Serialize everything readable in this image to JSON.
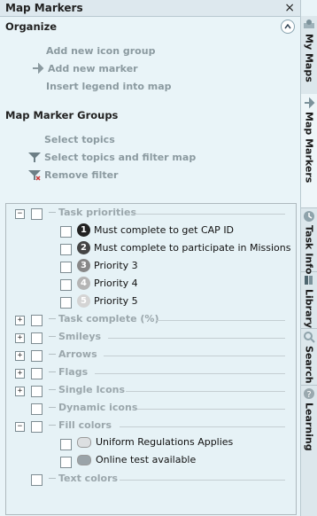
{
  "panel": {
    "title": "Map Markers",
    "close_glyph": "×"
  },
  "organize": {
    "heading": "Organize",
    "actions": [
      {
        "label": "Add new icon group",
        "icon": ""
      },
      {
        "label": "Add new marker",
        "icon": "pin-icon"
      },
      {
        "label": "Insert legend into map",
        "icon": ""
      }
    ]
  },
  "groups_section": {
    "heading": "Map Marker Groups",
    "actions": [
      {
        "label": "Select topics",
        "icon": ""
      },
      {
        "label": "Select topics and filter map",
        "icon": "filter-icon"
      },
      {
        "label": "Remove filter",
        "icon": "remove-filter-icon"
      }
    ]
  },
  "tree": {
    "task_priorities": {
      "label": "Task priorities",
      "items": [
        {
          "num": "1",
          "label": "Must complete to get CAP ID"
        },
        {
          "num": "2",
          "label": "Must complete to participate in Missions"
        },
        {
          "num": "3",
          "label": "Priority 3"
        },
        {
          "num": "4",
          "label": "Priority 4"
        },
        {
          "num": "5",
          "label": "Priority 5"
        }
      ]
    },
    "collapsed_groups": [
      "Task complete (%)",
      "Smileys",
      "Arrows",
      "Flags",
      "Single Icons"
    ],
    "dynamic_icons": "Dynamic icons",
    "fill_colors": {
      "label": "Fill colors",
      "items": [
        {
          "label": "Uniform Regulations Applies",
          "color": "#dcdfe1"
        },
        {
          "label": "Online test available",
          "color": "#9aa3a8"
        }
      ]
    },
    "text_colors": "Text colors"
  },
  "tabs": [
    {
      "label": "My Maps",
      "icon": "my-maps-icon"
    },
    {
      "label": "Map Markers",
      "icon": "map-markers-icon"
    },
    {
      "label": "Task Info",
      "icon": "task-info-icon"
    },
    {
      "label": "Library",
      "icon": "library-icon"
    },
    {
      "label": "Search",
      "icon": "search-icon"
    },
    {
      "label": "Learning",
      "icon": "learning-icon"
    }
  ],
  "colors": {
    "panel_bg": "#e9f4f8",
    "priority_fills": [
      "#222222",
      "#444444",
      "#888888",
      "#b5b5b5",
      "#d4d4d4"
    ]
  }
}
